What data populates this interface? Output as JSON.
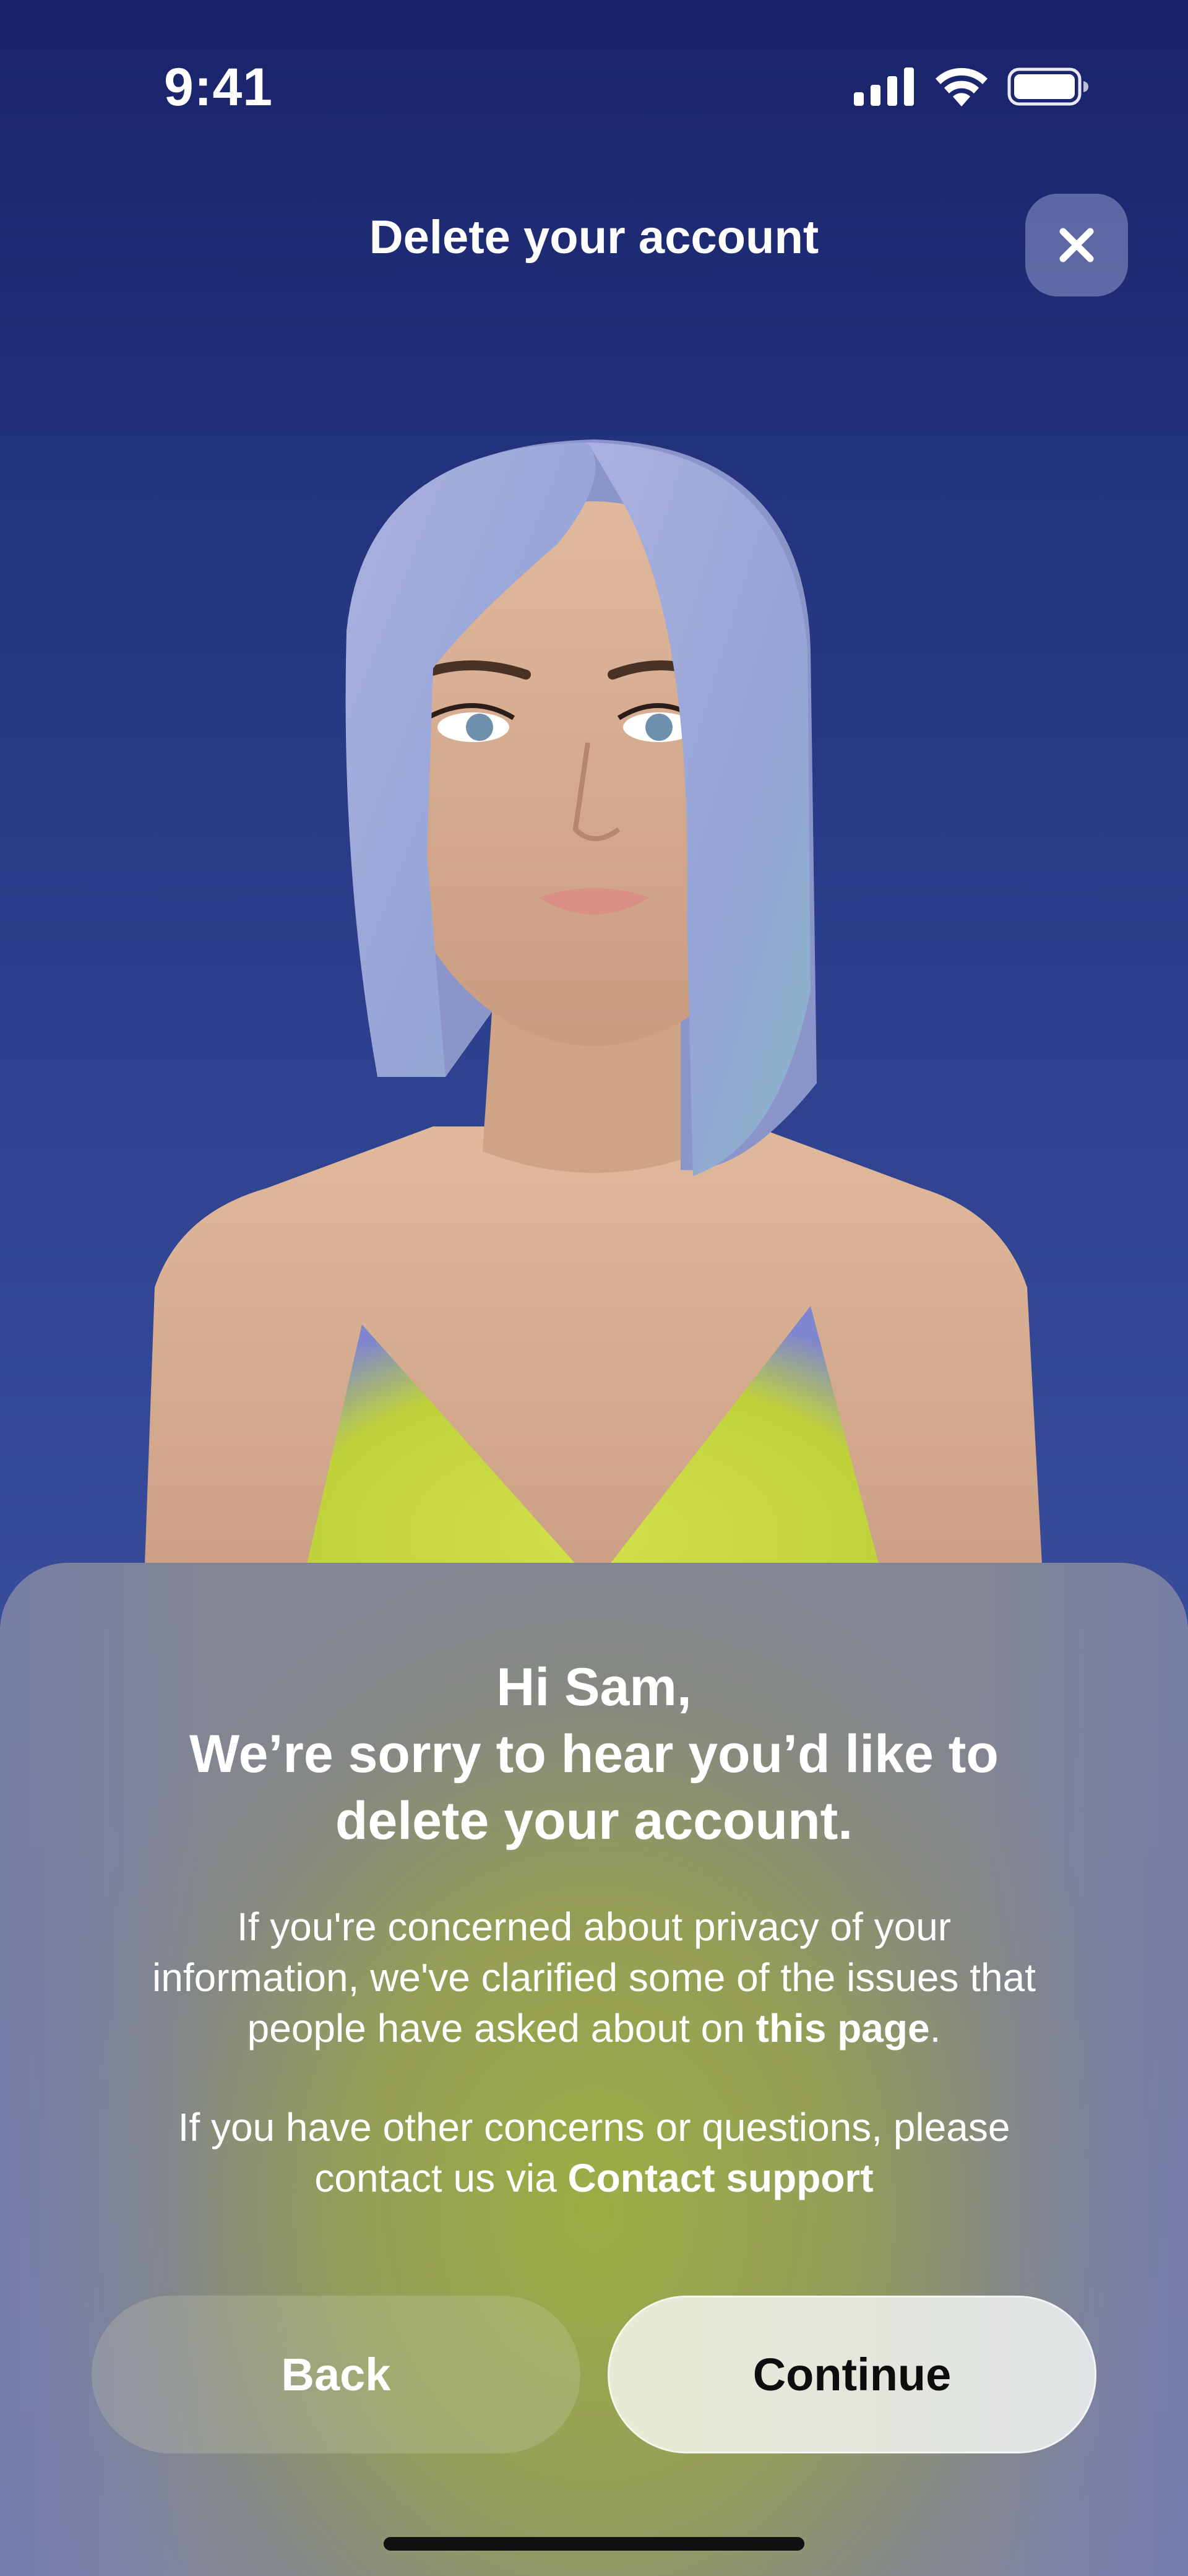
{
  "status_bar": {
    "time": "9:41",
    "icons": [
      "cellular-signal-icon",
      "wifi-icon",
      "battery-icon"
    ]
  },
  "header": {
    "title": "Delete your account",
    "close_icon": "close-icon"
  },
  "sheet": {
    "heading_lines": [
      "Hi Sam,",
      "We’re sorry to hear you’d like to",
      "delete your account."
    ],
    "paragraph_1": {
      "line_1": "If you're concerned about privacy of your",
      "line_2": "information, we've clarified some of the issues that",
      "line_3_prefix": "people have asked about on ",
      "link": "this page",
      "line_3_suffix": "."
    },
    "paragraph_2": {
      "line_1": "If you have other concerns or questions, please",
      "line_2_prefix": "contact us via ",
      "link": "Contact support"
    },
    "back_label": "Back",
    "continue_label": "Continue"
  },
  "colors": {
    "background_top": "#19236a",
    "background_bottom": "#4059a5",
    "hair": "#9aa6d8",
    "top_garment": "#c4d43c",
    "continue_button": "#e6e8dc"
  }
}
